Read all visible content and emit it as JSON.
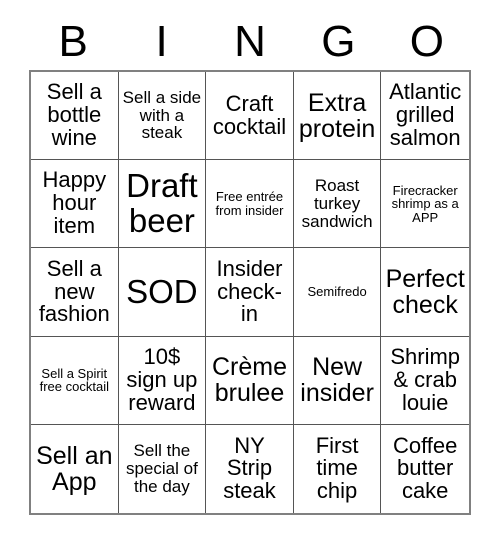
{
  "card": {
    "headers": [
      "B",
      "I",
      "N",
      "G",
      "O"
    ],
    "rows": [
      [
        {
          "text": "Sell a bottle wine",
          "size": "sz-md"
        },
        {
          "text": "Sell a side with a steak",
          "size": "sz-sm"
        },
        {
          "text": "Craft cocktail",
          "size": "sz-md"
        },
        {
          "text": "Extra protein",
          "size": "sz-lg"
        },
        {
          "text": "Atlantic grilled salmon",
          "size": "sz-md"
        }
      ],
      [
        {
          "text": "Happy hour item",
          "size": "sz-md"
        },
        {
          "text": "Draft beer",
          "size": "sz-xl"
        },
        {
          "text": "Free entrée from insider",
          "size": "sz-xs"
        },
        {
          "text": "Roast turkey sandwich",
          "size": "sz-sm"
        },
        {
          "text": "Firecracker shrimp as a APP",
          "size": "sz-xs"
        }
      ],
      [
        {
          "text": "Sell a new fashion",
          "size": "sz-md"
        },
        {
          "text": "SOD",
          "size": "sz-xl"
        },
        {
          "text": "Insider check-in",
          "size": "sz-md"
        },
        {
          "text": "Semifredo",
          "size": "sz-xs"
        },
        {
          "text": "Perfect check",
          "size": "sz-lg"
        }
      ],
      [
        {
          "text": "Sell a Spirit free cocktail",
          "size": "sz-xs"
        },
        {
          "text": "10$ sign up reward",
          "size": "sz-md"
        },
        {
          "text": "Crème brulee",
          "size": "sz-lg"
        },
        {
          "text": "New insider",
          "size": "sz-lg"
        },
        {
          "text": "Shrimp & crab louie",
          "size": "sz-md"
        }
      ],
      [
        {
          "text": "Sell an App",
          "size": "sz-lg"
        },
        {
          "text": "Sell the special of the day",
          "size": "sz-sm"
        },
        {
          "text": "NY Strip steak",
          "size": "sz-md"
        },
        {
          "text": "First time chip",
          "size": "sz-md"
        },
        {
          "text": "Coffee butter cake",
          "size": "sz-md"
        }
      ]
    ]
  }
}
